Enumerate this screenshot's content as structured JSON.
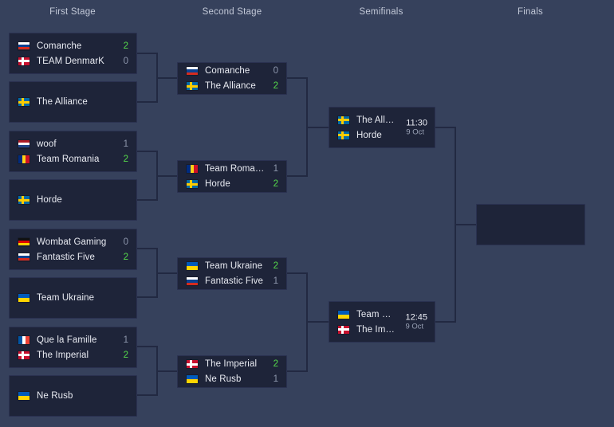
{
  "headers": [
    {
      "label": "First Stage"
    },
    {
      "label": "Second Stage"
    },
    {
      "label": "Semifinals"
    },
    {
      "label": "Finals"
    }
  ],
  "colors": {
    "background": "#36415c",
    "match_bg": "#1e2439",
    "match_border": "#2a3150",
    "line": "#222942",
    "win_score": "#55d94b",
    "lose_score": "#8e97ad",
    "team_text": "#e9ebf2",
    "header_text": "#c3c9d8"
  },
  "rounds": {
    "first_stage": {
      "label": "First Stage",
      "matches": [
        {
          "teams": [
            {
              "name": "Comanche",
              "flag": "russia",
              "score": "2",
              "result": "win"
            },
            {
              "name": "TEAM DenmarK",
              "flag": "denmark",
              "score": "0",
              "result": "lose"
            }
          ]
        },
        {
          "teams": [
            {
              "name": "The Alliance",
              "flag": "sweden",
              "score": "",
              "result": "none"
            }
          ]
        },
        {
          "teams": [
            {
              "name": "woof",
              "flag": "netherlands",
              "score": "1",
              "result": "lose"
            },
            {
              "name": "Team Romania",
              "flag": "romania",
              "score": "2",
              "result": "win"
            }
          ]
        },
        {
          "teams": [
            {
              "name": "Horde",
              "flag": "sweden",
              "score": "",
              "result": "none"
            }
          ]
        },
        {
          "teams": [
            {
              "name": "Wombat Gaming",
              "flag": "germany",
              "score": "0",
              "result": "lose"
            },
            {
              "name": "Fantastic Five",
              "flag": "russia",
              "score": "2",
              "result": "win"
            }
          ]
        },
        {
          "teams": [
            {
              "name": "Team Ukraine",
              "flag": "ukraine",
              "score": "",
              "result": "none"
            }
          ]
        },
        {
          "teams": [
            {
              "name": "Que la Famille",
              "flag": "france",
              "score": "1",
              "result": "lose"
            },
            {
              "name": "The Imperial",
              "flag": "denmark",
              "score": "2",
              "result": "win"
            }
          ]
        },
        {
          "teams": [
            {
              "name": "Ne Rusb",
              "flag": "ukraine",
              "score": "",
              "result": "none"
            }
          ]
        }
      ]
    },
    "second_stage": {
      "label": "Second Stage",
      "matches": [
        {
          "teams": [
            {
              "name": "Comanche",
              "flag": "russia",
              "score": "0",
              "result": "lose"
            },
            {
              "name": "The Alliance",
              "flag": "sweden",
              "score": "2",
              "result": "win"
            }
          ]
        },
        {
          "teams": [
            {
              "name": "Team Romania",
              "flag": "romania",
              "score": "1",
              "result": "lose"
            },
            {
              "name": "Horde",
              "flag": "sweden",
              "score": "2",
              "result": "win"
            }
          ]
        },
        {
          "teams": [
            {
              "name": "Team Ukraine",
              "flag": "ukraine",
              "score": "2",
              "result": "win"
            },
            {
              "name": "Fantastic Five",
              "flag": "russia",
              "score": "1",
              "result": "lose"
            }
          ]
        },
        {
          "teams": [
            {
              "name": "The Imperial",
              "flag": "denmark",
              "score": "2",
              "result": "win"
            },
            {
              "name": "Ne Rusb",
              "flag": "ukraine",
              "score": "1",
              "result": "lose"
            }
          ]
        }
      ]
    },
    "semifinals": {
      "label": "Semifinals",
      "matches": [
        {
          "time": "11:30",
          "date": "9 Oct",
          "teams": [
            {
              "name": "The Alliance",
              "flag": "sweden"
            },
            {
              "name": "Horde",
              "flag": "sweden"
            }
          ]
        },
        {
          "time": "12:45",
          "date": "9 Oct",
          "teams": [
            {
              "name": "Team Ukra...",
              "flag": "ukraine"
            },
            {
              "name": "The Imperial",
              "flag": "denmark"
            }
          ]
        }
      ]
    },
    "finals": {
      "label": "Finals",
      "matches": [
        {
          "teams": []
        }
      ]
    }
  }
}
